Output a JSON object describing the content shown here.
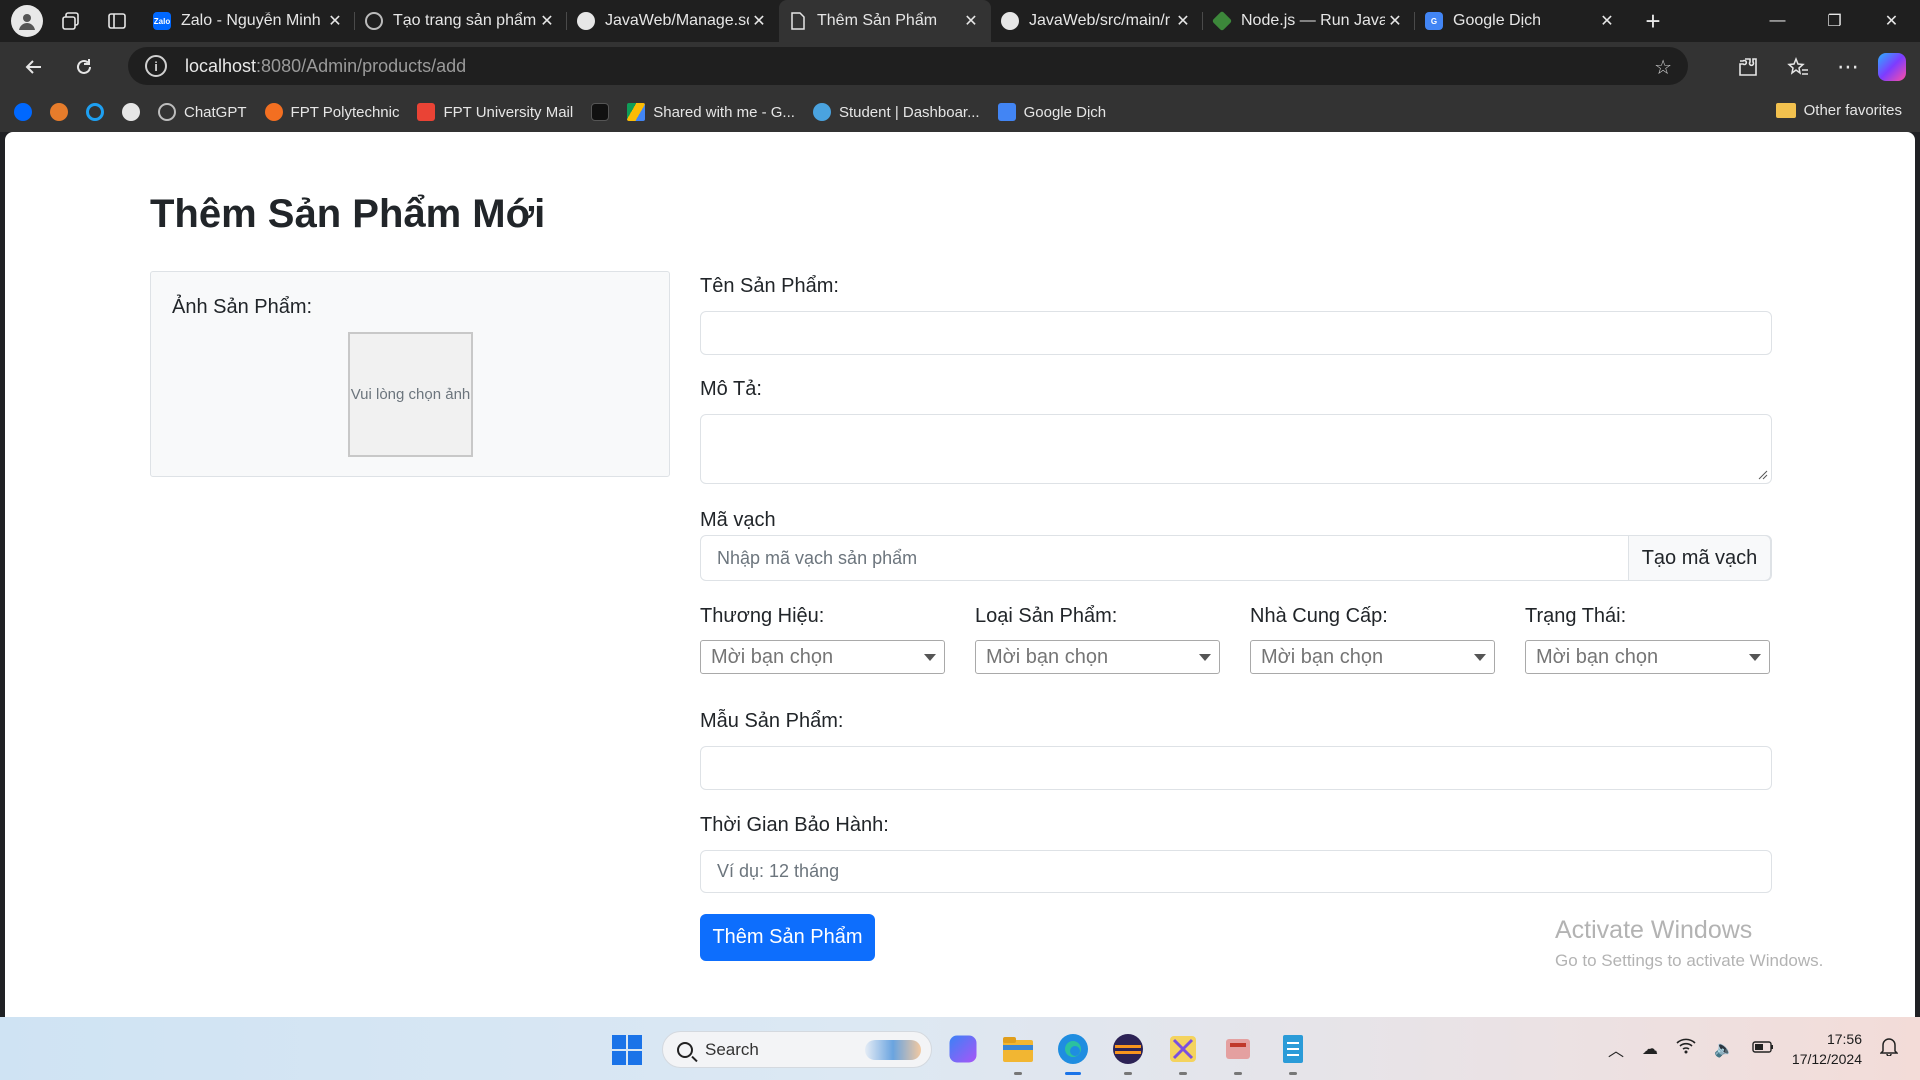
{
  "browser": {
    "tabs": [
      {
        "title": "Zalo - Nguyễn Minh",
        "icon": "zalo-icon",
        "color": "#0068ff"
      },
      {
        "title": "Tạo trang sản phẩm",
        "icon": "chatgpt-icon",
        "color": "#8a8a8a"
      },
      {
        "title": "JavaWeb/Manage.sq",
        "icon": "github-icon",
        "color": "#e6e6e6"
      },
      {
        "title": "Thêm Sản Phẩm",
        "icon": "page-icon",
        "color": "#e6e6e6",
        "active": true
      },
      {
        "title": "JavaWeb/src/main/r",
        "icon": "github-icon",
        "color": "#e6e6e6"
      },
      {
        "title": "Node.js — Run Java",
        "icon": "nodejs-icon",
        "color": "#3c873a"
      },
      {
        "title": "Google Dịch",
        "icon": "google-translate-icon",
        "color": "#4285f4"
      }
    ],
    "address": {
      "host": "localhost",
      "rest": ":8080/Admin/products/add"
    },
    "bookmarks": [
      {
        "label": "",
        "icon": "zalo-icon",
        "color": "#0068ff"
      },
      {
        "label": "",
        "icon": "cloud-icon",
        "color": "#e67c2b"
      },
      {
        "label": "",
        "icon": "circle-icon",
        "color": "#1ea0f2"
      },
      {
        "label": "",
        "icon": "github-icon",
        "color": "#e6e6e6"
      },
      {
        "label": "ChatGPT",
        "icon": "chatgpt-icon",
        "color": "#bdbdbd"
      },
      {
        "label": "FPT Polytechnic",
        "icon": "fpt-icon",
        "color": "#f36f21"
      },
      {
        "label": "FPT University Mail",
        "icon": "gmail-icon",
        "color": "#ea4335"
      },
      {
        "label": "",
        "icon": "tiktok-icon",
        "color": "#111111"
      },
      {
        "label": "Shared with me - G...",
        "icon": "google-drive-icon",
        "color": "#fbbc04"
      },
      {
        "label": "Student | Dashboar...",
        "icon": "student-icon",
        "color": "#4aa3df"
      },
      {
        "label": "Google Dịch",
        "icon": "google-translate-icon",
        "color": "#4285f4"
      }
    ],
    "other_favorites": "Other favorites"
  },
  "page": {
    "title": "Thêm Sản Phẩm Mới",
    "image_label": "Ảnh Sản Phẩm:",
    "image_placeholder": "Vui lòng chọn ảnh",
    "name_label": "Tên Sản Phẩm:",
    "name_value": "",
    "desc_label": "Mô Tả:",
    "barcode_label": "Mã vạch",
    "barcode_placeholder": "Nhập mã vạch sản phẩm",
    "barcode_button": "Tạo mã vạch",
    "brand_label": "Thương Hiệu:",
    "type_label": "Loại Sản Phẩm:",
    "supplier_label": "Nhà Cung Cấp:",
    "status_label": "Trạng Thái:",
    "select_placeholder": "Mời bạn chọn",
    "model_label": "Mẫu Sản Phẩm:",
    "warranty_label": "Thời Gian Bảo Hành:",
    "warranty_placeholder": "Ví dụ: 12 tháng",
    "submit": "Thêm Sản Phẩm",
    "primary_color": "#0d6efd"
  },
  "watermark": {
    "line1": "Activate Windows",
    "line2": "Go to Settings to activate Windows."
  },
  "taskbar": {
    "search": "Search",
    "time": "17:56",
    "date": "17/12/2024"
  }
}
